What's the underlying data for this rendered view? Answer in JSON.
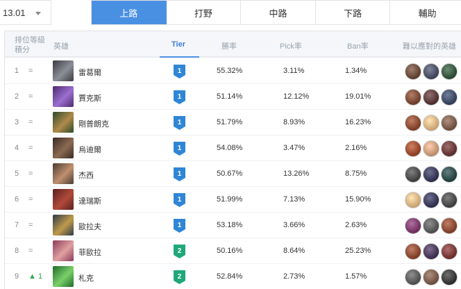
{
  "topbar": {
    "version": "13.01",
    "tabs": [
      "上路",
      "打野",
      "中路",
      "下路",
      "輔助"
    ],
    "active_tab": 0
  },
  "table": {
    "headers": {
      "rank_line1": "排位等級",
      "rank_line2": "積分",
      "champion": "英雄",
      "tier": "Tier",
      "win_rate": "勝率",
      "pick_rate": "Pick率",
      "ban_rate": "Ban率",
      "counters": "難以應對的英雄"
    },
    "rows": [
      {
        "rank": "1",
        "trend": "=",
        "trend_up": false,
        "name": "雷葛爾",
        "tier": "1",
        "win": "55.32%",
        "pick": "3.11%",
        "ban": "1.34%",
        "portrait_colors": [
          "#3b3a40",
          "#8c8f98"
        ],
        "counter_colors": [
          "#5a3a2a",
          "#3b3f56",
          "#26462e"
        ]
      },
      {
        "rank": "2",
        "trend": "=",
        "trend_up": false,
        "name": "賈克斯",
        "tier": "1",
        "win": "51.14%",
        "pick": "12.12%",
        "ban": "19.01%",
        "portrait_colors": [
          "#4d2a6e",
          "#9b6fd0"
        ],
        "counter_colors": [
          "#6b3a25",
          "#4a2a2a",
          "#2c3a55"
        ]
      },
      {
        "rank": "3",
        "trend": "=",
        "trend_up": false,
        "name": "剛普朗克",
        "tier": "1",
        "win": "51.79%",
        "pick": "8.93%",
        "ban": "16.23%",
        "portrait_colors": [
          "#2c4a2a",
          "#b08a4a"
        ],
        "counter_colors": [
          "#7a3a22",
          "#c8a070",
          "#6a4a3a"
        ]
      },
      {
        "rank": "4",
        "trend": "=",
        "trend_up": false,
        "name": "烏迪爾",
        "tier": "1",
        "win": "54.08%",
        "pick": "3.47%",
        "ban": "2.16%",
        "portrait_colors": [
          "#3a2a22",
          "#8a6a52"
        ],
        "counter_colors": [
          "#8a3a1e",
          "#b88a6a",
          "#5a2a2a"
        ]
      },
      {
        "rank": "5",
        "trend": "=",
        "trend_up": false,
        "name": "杰西",
        "tier": "1",
        "win": "50.67%",
        "pick": "13.26%",
        "ban": "8.75%",
        "portrait_colors": [
          "#4a3a32",
          "#c09070"
        ],
        "counter_colors": [
          "#3a3a3a",
          "#2a2a4a",
          "#1e3a3a"
        ]
      },
      {
        "rank": "6",
        "trend": "=",
        "trend_up": false,
        "name": "達瑞斯",
        "tier": "1",
        "win": "51.99%",
        "pick": "7.13%",
        "ban": "15.90%",
        "portrait_colors": [
          "#5a1e1e",
          "#b04a3a"
        ],
        "counter_colors": [
          "#c8a070",
          "#2a2a4a",
          "#3a3a3a"
        ]
      },
      {
        "rank": "7",
        "trend": "=",
        "trend_up": false,
        "name": "歐拉夫",
        "tier": "1",
        "win": "53.18%",
        "pick": "3.66%",
        "ban": "2.63%",
        "portrait_colors": [
          "#2a3a4a",
          "#c09a4a"
        ],
        "counter_colors": [
          "#6a2a5a",
          "#4a4a4a",
          "#7a3a22"
        ]
      },
      {
        "rank": "8",
        "trend": "=",
        "trend_up": false,
        "name": "菲歐拉",
        "tier": "2",
        "win": "50.16%",
        "pick": "8.64%",
        "ban": "25.23%",
        "portrait_colors": [
          "#8a3a5a",
          "#e0a0a0"
        ],
        "counter_colors": [
          "#7a3a22",
          "#3a2a4a",
          "#6a2a2a"
        ]
      },
      {
        "rank": "9",
        "trend": "▲ 1",
        "trend_up": true,
        "name": "札克",
        "tier": "2",
        "win": "52.84%",
        "pick": "2.73%",
        "ban": "1.57%",
        "portrait_colors": [
          "#1e6a2a",
          "#7ad06a"
        ],
        "counter_colors": [
          "#4a4a4a",
          "#6a4a3a",
          "#2a2a2a"
        ]
      }
    ]
  },
  "colors": {
    "accent": "#4a90e2",
    "tier1": "#2f86d6",
    "tier2": "#1fa87a"
  }
}
